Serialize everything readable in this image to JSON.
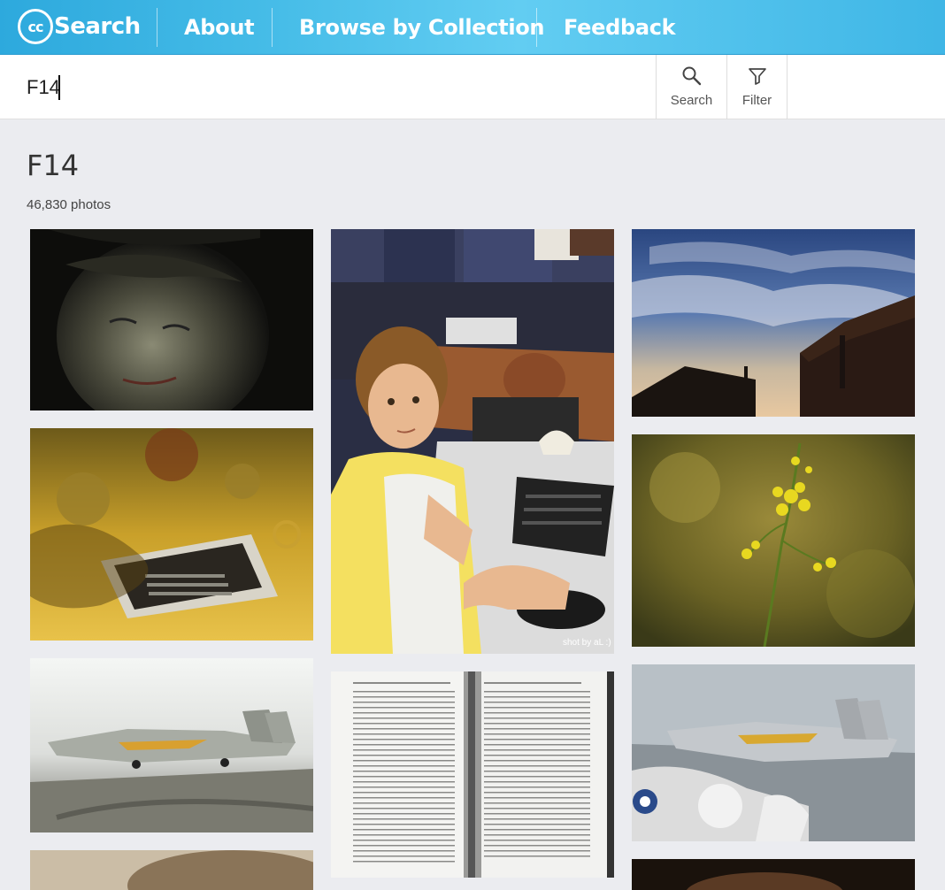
{
  "header": {
    "logo_text": "Search",
    "logo_mark": "cc",
    "nav": [
      "About",
      "Browse by Collection",
      "Feedback"
    ]
  },
  "searchbar": {
    "query": "F14",
    "search_label": "Search",
    "filter_label": "Filter",
    "search_icon": "magnifier-icon",
    "filter_icon": "funnel-icon"
  },
  "results": {
    "title": "F14",
    "count": "46,830 photos",
    "photos": [
      {
        "subject": "man-face-dark"
      },
      {
        "subject": "boy-at-computer"
      },
      {
        "subject": "sky-rooftops"
      },
      {
        "subject": "phone-yellow-bokeh"
      },
      {
        "subject": "yellow-flowers"
      },
      {
        "subject": "f14-jet-deck"
      },
      {
        "subject": "open-book"
      },
      {
        "subject": "f14-jets-carrier"
      },
      {
        "subject": "partial-photo"
      },
      {
        "subject": "partial-photo-dark"
      }
    ],
    "watermark": "shot by aL :)"
  },
  "colors": {
    "header_start": "#2da9dd",
    "header_end": "#62cdf2",
    "page_bg": "#ebecf0"
  }
}
